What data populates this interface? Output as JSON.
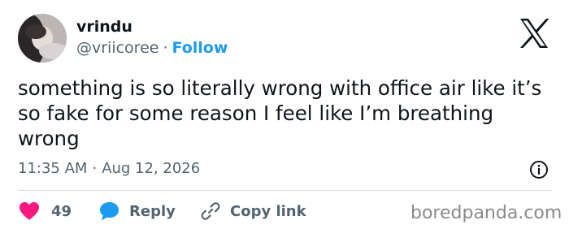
{
  "author": {
    "name": "vrindu",
    "handle": "@vriicoree",
    "separator": "·",
    "follow_label": "Follow"
  },
  "platform_icon": "x-logo-icon",
  "tweet": {
    "text": "something is so literally wrong with office air like it’s so fake for some reason I feel like I’m breathing wrong",
    "time": "11:35 AM",
    "separator": "·",
    "date": "Aug 12, 2026"
  },
  "actions": {
    "like_count": "49",
    "reply_label": "Reply",
    "copy_link_label": "Copy link"
  },
  "watermark": "boredpanda.com",
  "colors": {
    "accent": "#1d9bf0",
    "like": "#f91880",
    "text": "#0f1419",
    "muted": "#536471",
    "divider": "#cfd9de"
  }
}
